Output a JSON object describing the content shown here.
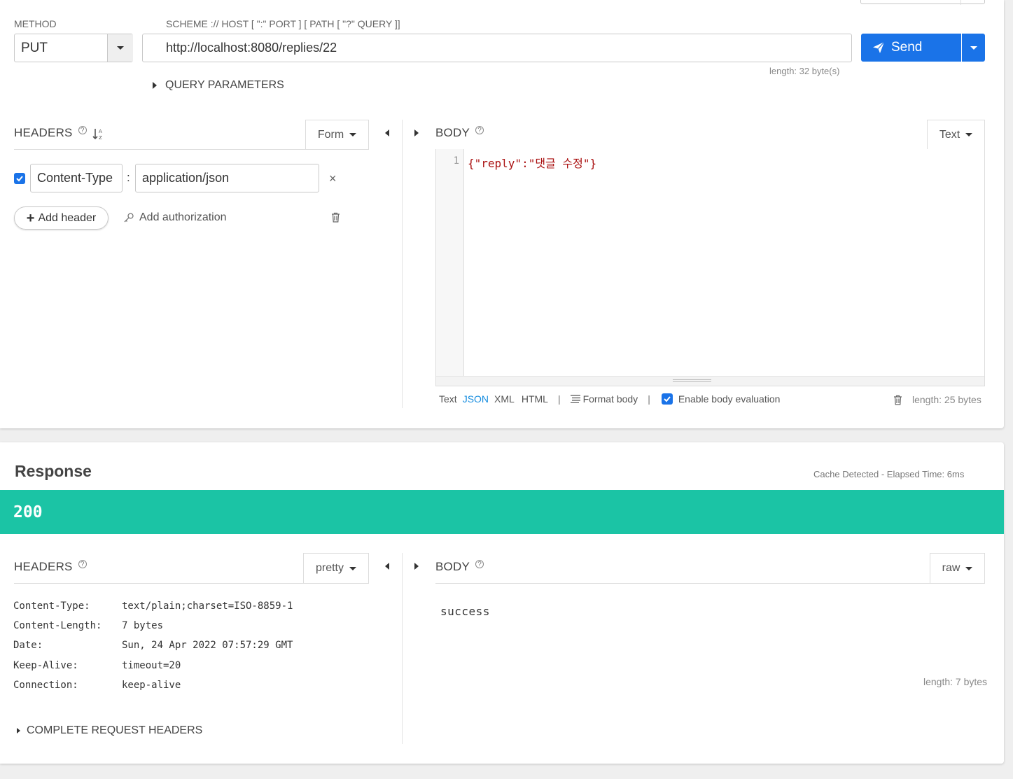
{
  "request": {
    "method_label": "METHOD",
    "method_value": "PUT",
    "url_label": "SCHEME :// HOST [ \":\" PORT ] [ PATH [ \"?\" QUERY ]]",
    "url_value": "http://localhost:8080/replies/22",
    "url_length": "length: 32 byte(s)",
    "send_label": "Send",
    "query_params_label": "QUERY PARAMETERS",
    "headers_title": "HEADERS",
    "headers_mode": "Form",
    "header_rows": [
      {
        "enabled": true,
        "key": "Content-Type",
        "value": "application/json"
      }
    ],
    "add_header_label": "Add header",
    "add_auth_label": "Add authorization",
    "body_title": "BODY",
    "body_mode": "Text",
    "body_line_number": "1",
    "body_content": "{\"reply\":\"댓글 수정\"}",
    "body_types": [
      "Text",
      "JSON",
      "XML",
      "HTML"
    ],
    "body_type_active": "JSON",
    "format_body_label": "Format body",
    "enable_eval_label": "Enable body evaluation",
    "body_length": "length: 25 bytes"
  },
  "response": {
    "title": "Response",
    "cache_info": "Cache Detected - Elapsed Time: 6ms",
    "status_code": "200",
    "status_color": "#1bc4a5",
    "headers_title": "HEADERS",
    "headers_mode": "pretty",
    "headers": [
      {
        "key": "Content-Type:",
        "value": "text/plain;charset=ISO-8859-1"
      },
      {
        "key": "Content-Length:",
        "value": "7 bytes"
      },
      {
        "key": "Date:",
        "value": "Sun, 24 Apr 2022 07:57:29 GMT"
      },
      {
        "key": "Keep-Alive:",
        "value": "timeout=20"
      },
      {
        "key": "Connection:",
        "value": "keep-alive"
      }
    ],
    "complete_headers_label": "COMPLETE REQUEST HEADERS",
    "body_title": "BODY",
    "body_mode": "raw",
    "body_content": "success",
    "body_length": "length: 7 bytes"
  },
  "colors": {
    "accent": "#1a73e8",
    "success": "#1bc4a5",
    "link": "#1a8fe0"
  }
}
